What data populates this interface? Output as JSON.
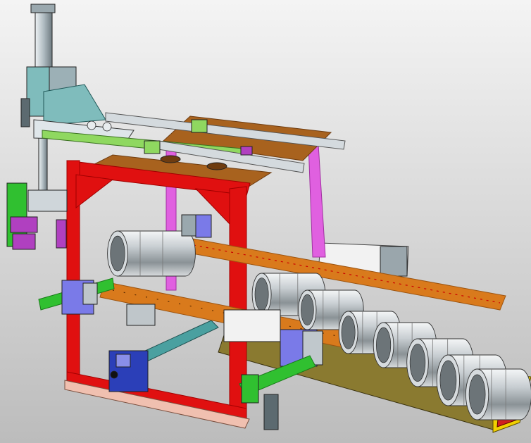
{
  "viewport": {
    "background_top": "#f4f4f4",
    "background_bottom": "#bcbcbc"
  },
  "colors": {
    "frame_red": "#e01010",
    "frame_red_dark": "#a00000",
    "rail_orange": "#d97a1c",
    "rail_orange_dark": "#9c5410",
    "plate_brown": "#a8621e",
    "plate_brown_dark": "#6e3c10",
    "upright_magenta": "#e060e0",
    "upright_magenta_dark": "#a030a0",
    "column_steel": "#8fa0a8",
    "column_steel_light": "#dfe6ea",
    "bracket_teal": "#7fbcbc",
    "gripper_green": "#30c030",
    "gripper_green_dark": "#1a7a1a",
    "gripper_purple": "#b040c0",
    "motor_blue": "#2b3fb8",
    "motor_blue_light": "#8a8fe8",
    "rail_green": "#8fd860",
    "rail_silver": "#d4dade",
    "can_silver": "#c8ced2",
    "can_shadow": "#6c7478",
    "conveyor_olive": "#8a7a30",
    "base_pink": "#f0c0b0",
    "end_cap_yellow": "#f0d000",
    "end_cap_red": "#d02020",
    "block_white": "#f2f2f2"
  },
  "components": {
    "can_count": 8
  }
}
